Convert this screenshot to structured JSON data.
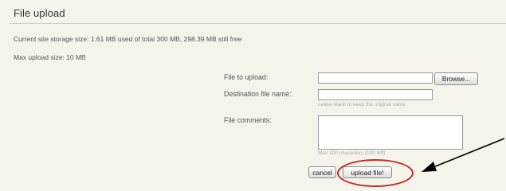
{
  "header": {
    "title": "File upload"
  },
  "info": {
    "storage": "Current site storage size: 1.61 MB used of total 300 MB, 298.39 MB still free",
    "max_upload": "Max upload size: 10 MB"
  },
  "form": {
    "file_to_upload_label": "File to upload:",
    "browse_label": "Browse...",
    "destination_label": "Destination file name:",
    "destination_value": "",
    "destination_hint": "Leave blank to keep the original name.",
    "comments_label": "File comments:",
    "comments_value": "",
    "comments_hint": "Max 100 characters (100 left)",
    "cancel_label": "cancel",
    "upload_label": "upload file!"
  },
  "annotation": {
    "ring_color": "#c22a2a",
    "arrow_color": "#000000"
  }
}
